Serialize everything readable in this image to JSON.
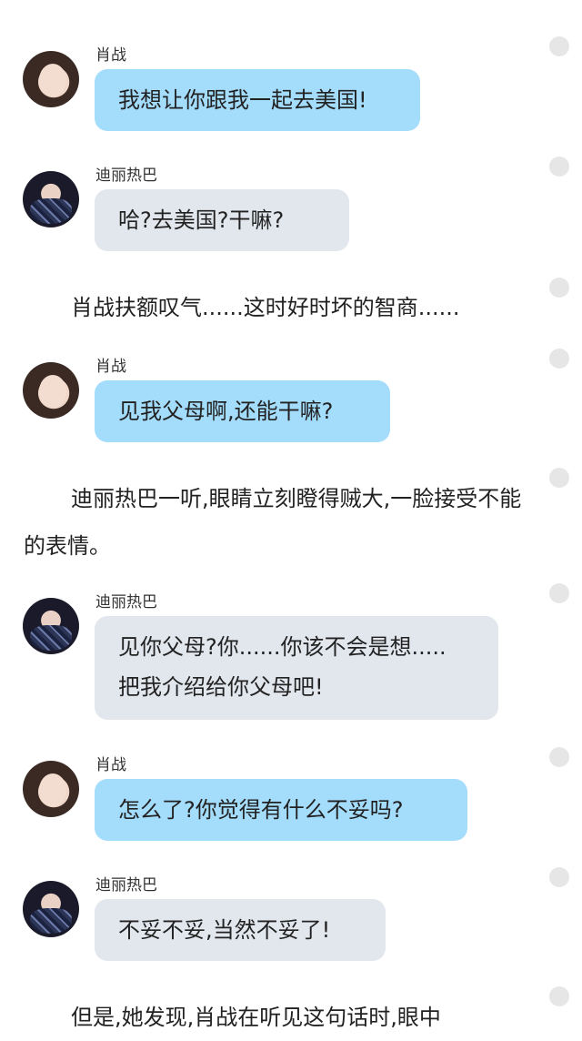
{
  "messages": [
    {
      "name": "肖战",
      "lines": [
        "我想让你跟我一起去美国!"
      ]
    },
    {
      "name": "迪丽热巴",
      "lines": [
        "哈?去美国?干嘛?"
      ]
    },
    {
      "name": "肖战",
      "lines": [
        "见我父母啊,还能干嘛?"
      ]
    },
    {
      "name": "迪丽热巴",
      "lines": [
        "见你父母?你......你该不会是想.....",
        "把我介绍给你父母吧!"
      ]
    },
    {
      "name": "肖战",
      "lines": [
        "怎么了?你觉得有什么不妥吗?"
      ]
    },
    {
      "name": "迪丽热巴",
      "lines": [
        "不妥不妥,当然不妥了!"
      ]
    }
  ],
  "narration": [
    "肖战扶额叹气......这时好时坏的智商......",
    "迪丽热巴一听,眼睛立刻瞪得贼大,一脸接受不能的表情。",
    "但是,她发现,肖战在听见这句话时,眼中"
  ],
  "colors": {
    "self_bubble": "#a4dcfc",
    "other_bubble": "#e2e7ee"
  }
}
